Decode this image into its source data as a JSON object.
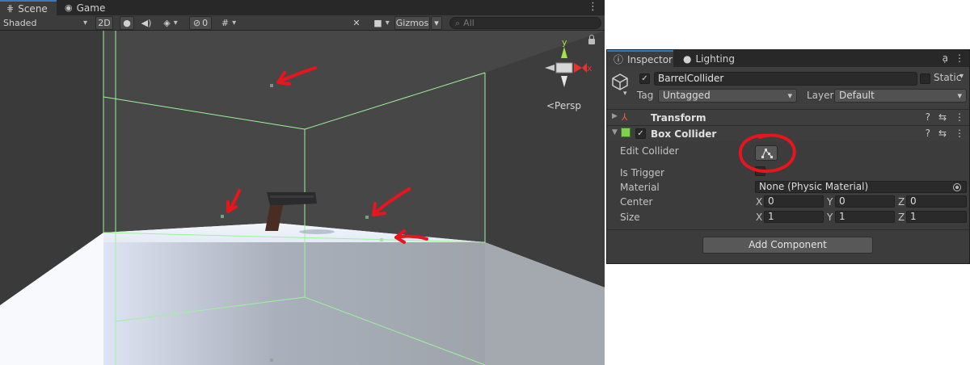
{
  "scene": {
    "tabs": [
      {
        "label": "Scene",
        "icon": "grid-icon"
      },
      {
        "label": "Game",
        "icon": "gamepad-icon"
      }
    ],
    "toolbar": {
      "shading_mode": "Shaded",
      "mode_2d": "2D",
      "hidden_count": "0",
      "gizmos": "Gizmos",
      "search_placeholder": "All"
    },
    "gizmo": {
      "y_axis": "y",
      "x_axis": "x",
      "projection": "<Persp"
    },
    "annotation_color": "#e8141e",
    "collider_color": "#9ef29e"
  },
  "inspector": {
    "tabs": [
      {
        "label": "Inspector",
        "icon": "info-icon"
      },
      {
        "label": "Lighting",
        "icon": "light-bulb-icon"
      }
    ],
    "object": {
      "active": true,
      "name": "BarrelCollider",
      "static_label": "Static",
      "tag_label": "Tag",
      "tag_value": "Untagged",
      "layer_label": "Layer",
      "layer_value": "Default"
    },
    "components": [
      {
        "title": "Transform",
        "expanded": false,
        "icon": "transform-icon"
      },
      {
        "title": "Box Collider",
        "expanded": true,
        "enabled": true,
        "icon": "box-collider-icon"
      }
    ],
    "box_collider": {
      "edit_collider_label": "Edit Collider",
      "is_trigger_label": "Is Trigger",
      "is_trigger": false,
      "material_label": "Material",
      "material_value": "None (Physic Material)",
      "center_label": "Center",
      "center": {
        "x": "0",
        "y": "0",
        "z": "0"
      },
      "size_label": "Size",
      "size": {
        "x": "1",
        "y": "1",
        "z": "1"
      }
    },
    "add_component": "Add Component"
  }
}
